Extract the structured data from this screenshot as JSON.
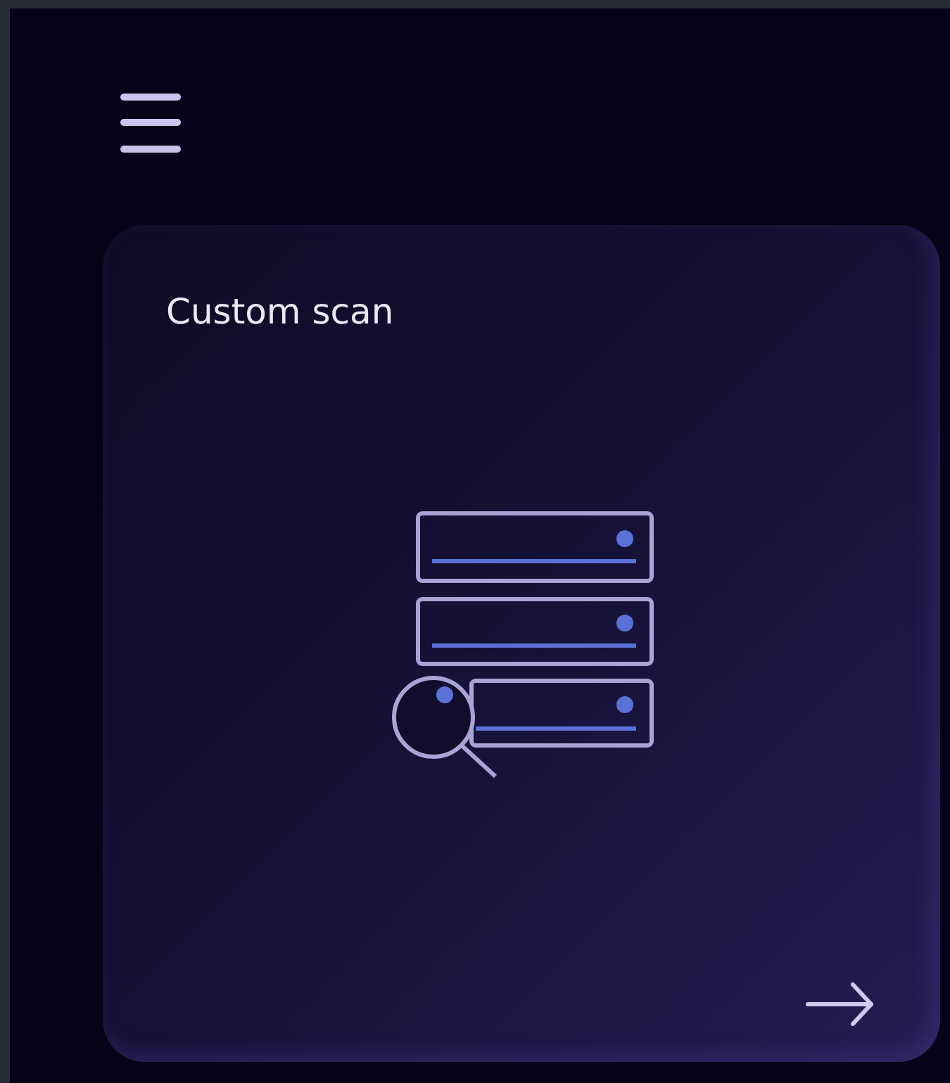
{
  "card": {
    "title": "Custom scan"
  }
}
